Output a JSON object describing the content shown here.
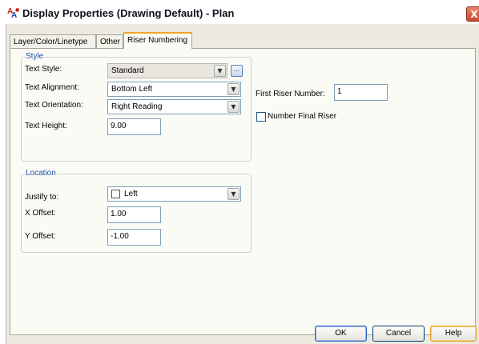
{
  "window": {
    "title": "Display Properties (Drawing Default) - Plan",
    "app_icon": "autocad-architecture-icon",
    "close_label": "X"
  },
  "tabs": [
    {
      "label": "Layer/Color/Linetype",
      "active": false
    },
    {
      "label": "Other",
      "active": false
    },
    {
      "label": "Riser Numbering",
      "active": true
    }
  ],
  "style_group": {
    "legend": "Style",
    "text_style": {
      "label": "Text Style:",
      "value": "Standard",
      "ellipsis": "..."
    },
    "text_alignment": {
      "label": "Text Alignment:",
      "value": "Bottom Left"
    },
    "text_orientation": {
      "label": "Text Orientation:",
      "value": "Right Reading"
    },
    "text_height": {
      "label": "Text Height:",
      "value": "9.00"
    }
  },
  "location_group": {
    "legend": "Location",
    "justify_to": {
      "label": "Justify to:",
      "value": "Left"
    },
    "x_offset": {
      "label": "X Offset:",
      "value": "1.00"
    },
    "y_offset": {
      "label": "Y Offset:",
      "value": "-1.00"
    }
  },
  "riser": {
    "first_riser_label": "First Riser Number:",
    "first_riser_value": "1",
    "number_final_riser_label": "Number Final Riser",
    "number_final_riser_checked": false
  },
  "buttons": {
    "ok": "OK",
    "cancel": "Cancel",
    "help": "Help"
  },
  "colors": {
    "accent_tab": "#f0a62b",
    "legend": "#1e50a2",
    "dialog_bg": "#eceae0"
  }
}
